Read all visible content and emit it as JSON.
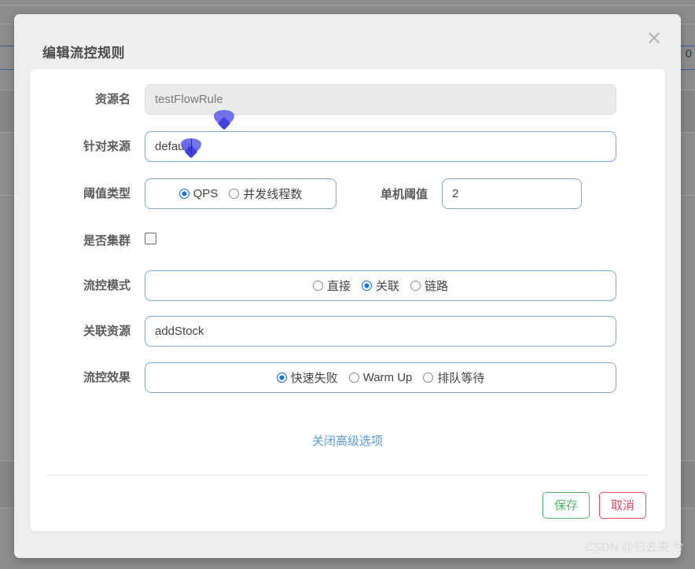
{
  "background": {
    "partial_cell_value": "0"
  },
  "modal": {
    "title": "编辑流控规则",
    "close_icon": "close-icon"
  },
  "form": {
    "resource": {
      "label": "资源名",
      "value": "testFlowRule",
      "readonly": true
    },
    "origin": {
      "label": "针对来源",
      "value": "default"
    },
    "threshold_type": {
      "label": "阈值类型",
      "options": [
        {
          "label": "QPS",
          "selected": true
        },
        {
          "label": "并发线程数",
          "selected": false
        }
      ]
    },
    "single_threshold": {
      "label": "单机阈值",
      "value": "2"
    },
    "cluster": {
      "label": "是否集群",
      "checked": false
    },
    "flow_mode": {
      "label": "流控模式",
      "options": [
        {
          "label": "直接",
          "selected": false
        },
        {
          "label": "关联",
          "selected": true
        },
        {
          "label": "链路",
          "selected": false
        }
      ]
    },
    "ref_resource": {
      "label": "关联资源",
      "value": "addStock"
    },
    "flow_effect": {
      "label": "流控效果",
      "options": [
        {
          "label": "快速失败",
          "selected": true
        },
        {
          "label": "Warm Up",
          "selected": false
        },
        {
          "label": "排队等待",
          "selected": false
        }
      ]
    }
  },
  "advanced_link": "关闭高级选项",
  "footer": {
    "save_label": "保存",
    "cancel_label": "取消"
  },
  "watermark": "CSDN @归去来 兮",
  "colors": {
    "accent_blue": "#1574ec",
    "border_blue": "#7aa7d4",
    "link_blue": "#5b9bd5",
    "save_green": "#52b868",
    "cancel_red": "#e04a5f",
    "modal_bg": "#eeeeee",
    "backdrop": "#8d8d8d"
  }
}
